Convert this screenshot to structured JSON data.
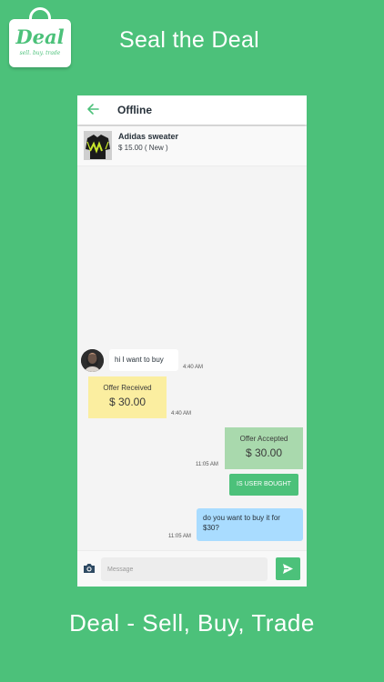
{
  "header": {
    "logo_word": "Deal",
    "logo_tagline": "sell. buy. trade",
    "headline": "Seal the Deal"
  },
  "screen": {
    "status_title": "Offline",
    "product": {
      "name": "Adidas sweater",
      "price": "$ 15.00 ( New )"
    },
    "messages": {
      "incoming_text": "hi I want to buy",
      "incoming_time": "4:40 AM",
      "offer_received_label": "Offer Received",
      "offer_received_amount": "$  30.00",
      "offer_received_time": "4:40 AM",
      "offer_accepted_label": "Offer Accepted",
      "offer_accepted_amount": "$  30.00",
      "offer_accepted_time": "11:05 AM",
      "bought_button_label": "IS USER BOUGHT",
      "outgoing_text": "do you want to buy it for $30?",
      "outgoing_time": "11:05 AM"
    },
    "composer": {
      "placeholder": "Message"
    }
  },
  "footer": {
    "title": "Deal - Sell, Buy, Trade"
  },
  "colors": {
    "brand_green": "#4cc17a",
    "offer_received_bg": "#fbeea0",
    "offer_accepted_bg": "#a9d9ad",
    "outgoing_bubble_bg": "#a9dcff"
  },
  "icons": {
    "back": "arrow-left-icon",
    "camera": "camera-icon",
    "send": "send-icon"
  }
}
